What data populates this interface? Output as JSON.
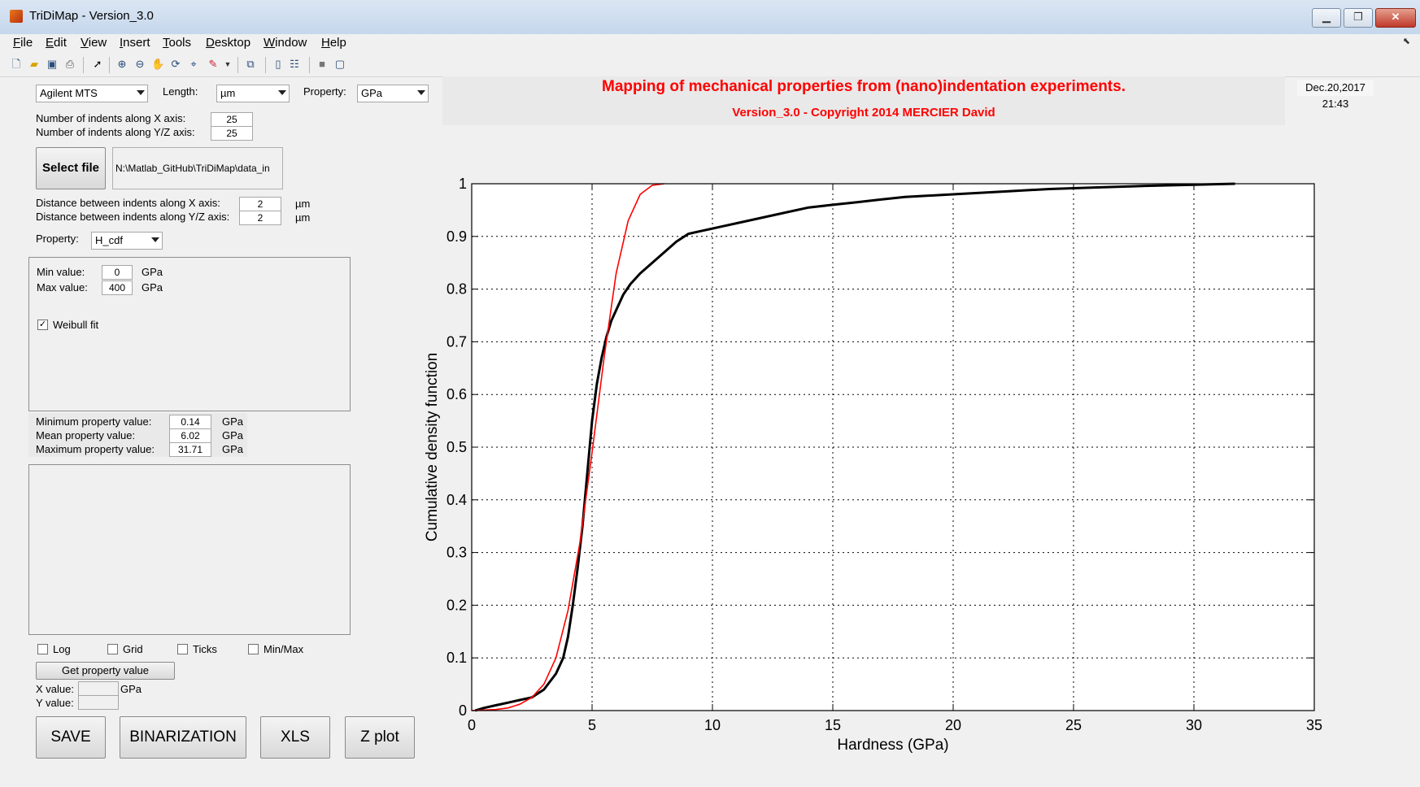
{
  "window": {
    "title": "TriDiMap - Version_3.0",
    "minimize": "▁",
    "restore": "❐",
    "close": "✕"
  },
  "menu": [
    "File",
    "Edit",
    "View",
    "Insert",
    "Tools",
    "Desktop",
    "Window",
    "Help"
  ],
  "toolbar_icons": [
    "new-file-icon",
    "open-folder-icon",
    "save-disk-icon",
    "print-icon",
    "pointer-arrow-icon",
    "zoom-in-icon",
    "zoom-out-icon",
    "pan-hand-icon",
    "rotate-3d-icon",
    "data-cursor-icon",
    "brush-icon",
    "print-preview-icon",
    "colorbar-icon",
    "legend-icon",
    "hide-plot-tools-icon",
    "show-plot-tools-icon"
  ],
  "controls": {
    "instrument": "Agilent MTS",
    "length_label": "Length:",
    "length_unit": "µm",
    "property_unit_label": "Property:",
    "property_unit": "GPa",
    "indents_x_label": "Number of indents along X axis:",
    "indents_x": "25",
    "indents_y_label": "Number of indents along Y/Z axis:",
    "indents_y": "25",
    "select_file": "Select file",
    "file_path": "N:\\Matlab_GitHub\\TriDiMap\\data_in",
    "dist_x_label": "Distance between indents along X axis:",
    "dist_x": "2",
    "dist_x_unit": "µm",
    "dist_y_label": "Distance between indents along Y/Z axis:",
    "dist_y": "2",
    "dist_y_unit": "µm",
    "property_label": "Property:",
    "property": "H_cdf",
    "min_label": "Min value:",
    "min_value": "0",
    "min_unit": "GPa",
    "max_label": "Max value:",
    "max_value": "400",
    "max_unit": "GPa",
    "weibull_label": "Weibull fit",
    "weibull_checked": "✓",
    "minprop_label": "Minimum property value:",
    "minprop": "0.14",
    "meanprop_label": "Mean property value:",
    "meanprop": "6.02",
    "maxprop_label": "Maximum property value:",
    "maxprop": "31.71",
    "gpa": "GPa",
    "log_label": "Log",
    "grid_label": "Grid",
    "ticks_label": "Ticks",
    "minmax_label": "Min/Max",
    "get_value": "Get property value",
    "xvalue_label": "X value:",
    "yvalue_label": "Y value:",
    "xvalue_unit": "GPa",
    "save": "SAVE",
    "binarization": "BINARIZATION",
    "xls": "XLS",
    "zplot": "Z plot"
  },
  "header": {
    "title": "Mapping of mechanical properties from (nano)indentation experiments.",
    "subtitle": "Version_3.0 - Copyright 2014 MERCIER David",
    "date": "Dec.20,2017 21:43"
  },
  "chart_data": {
    "type": "line",
    "xlabel": "Hardness (GPa)",
    "ylabel": "Cumulative density function",
    "xlim": [
      0,
      35
    ],
    "ylim": [
      0,
      1
    ],
    "xticks": [
      0,
      5,
      10,
      15,
      20,
      25,
      30,
      35
    ],
    "yticks": [
      0,
      0.1,
      0.2,
      0.3,
      0.4,
      0.5,
      0.6,
      0.7,
      0.8,
      0.9,
      1
    ],
    "grid": true,
    "series": [
      {
        "color": "#000000",
        "x": [
          0.14,
          0.5,
          1.0,
          1.5,
          2.0,
          2.5,
          3.0,
          3.5,
          3.8,
          4.0,
          4.2,
          4.4,
          4.6,
          4.8,
          5.0,
          5.2,
          5.4,
          5.6,
          5.8,
          6.0,
          6.3,
          6.6,
          7.0,
          7.5,
          8.0,
          8.5,
          9.0,
          9.5,
          10.0,
          11.0,
          12.0,
          13.0,
          14.0,
          15.0,
          16.0,
          17.0,
          18.0,
          20.0,
          22.0,
          24.0,
          26.0,
          28.0,
          30.0,
          31.71
        ],
        "y": [
          0.0,
          0.005,
          0.01,
          0.015,
          0.02,
          0.025,
          0.04,
          0.07,
          0.1,
          0.14,
          0.2,
          0.27,
          0.35,
          0.45,
          0.55,
          0.62,
          0.67,
          0.71,
          0.74,
          0.76,
          0.79,
          0.81,
          0.83,
          0.85,
          0.87,
          0.89,
          0.905,
          0.91,
          0.915,
          0.925,
          0.935,
          0.945,
          0.955,
          0.96,
          0.965,
          0.97,
          0.975,
          0.98,
          0.985,
          0.99,
          0.993,
          0.996,
          0.998,
          1.0
        ]
      },
      {
        "color": "#ff0000",
        "x": [
          0,
          1,
          1.5,
          2,
          2.5,
          3,
          3.5,
          4,
          4.5,
          5,
          5.5,
          6,
          6.5,
          7,
          7.5,
          8
        ],
        "y": [
          0,
          0.002,
          0.005,
          0.012,
          0.025,
          0.05,
          0.1,
          0.19,
          0.32,
          0.49,
          0.67,
          0.83,
          0.93,
          0.98,
          0.997,
          1.0
        ]
      }
    ]
  }
}
